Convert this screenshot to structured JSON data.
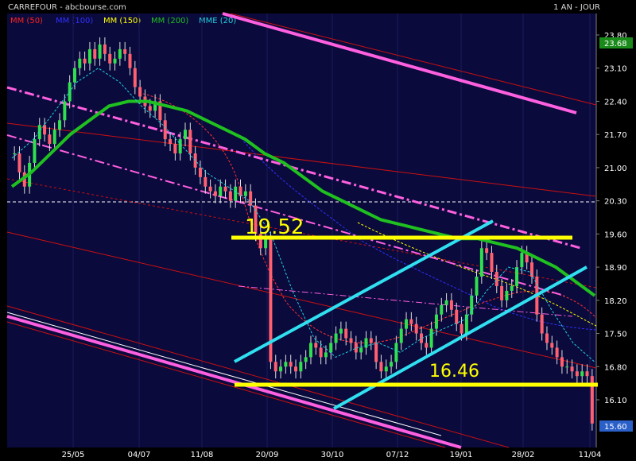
{
  "header": {
    "title": "CARREFOUR - abcbourse.com",
    "period": "1 AN - JOUR"
  },
  "legend": [
    {
      "label": "MM (50)",
      "color": "#ff2020"
    },
    {
      "label": "MM (100)",
      "color": "#2020ff"
    },
    {
      "label": "MM (150)",
      "color": "#ffff00"
    },
    {
      "label": "MM (200)",
      "color": "#20c020"
    },
    {
      "label": "MME (20)",
      "color": "#20d0e0"
    }
  ],
  "annotations": {
    "resistance_label": "19.52",
    "support_label": "16.46"
  },
  "chart_data": {
    "type": "line",
    "title": "CARREFOUR - abcbourse.com",
    "period": "1 AN - JOUR",
    "y_ticks": [
      "23.80",
      "23.10",
      "22.40",
      "21.70",
      "21.00",
      "20.30",
      "19.60",
      "18.90",
      "18.20",
      "17.50",
      "16.80",
      "16.10"
    ],
    "x_ticks": [
      "25/05",
      "04/07",
      "11/08",
      "20/09",
      "30/10",
      "07/12",
      "19/01",
      "28/02",
      "11/04"
    ],
    "ylim": [
      15.4,
      24.0
    ],
    "last_price_label": "23.68",
    "last_close_label": "15.60",
    "reference_price": 20.3,
    "levels": [
      {
        "name": "resistance",
        "value": 19.52,
        "color": "#ffff00"
      },
      {
        "name": "support",
        "value": 16.46,
        "color": "#ffff00"
      }
    ],
    "close": [
      21.3,
      20.9,
      20.6,
      21.1,
      21.6,
      21.9,
      21.7,
      21.5,
      21.8,
      22.0,
      22.4,
      22.8,
      23.1,
      23.3,
      23.2,
      23.5,
      23.3,
      23.6,
      23.4,
      23.2,
      23.3,
      23.5,
      23.4,
      23.1,
      22.7,
      22.5,
      22.3,
      22.2,
      22.4,
      22.0,
      21.6,
      21.5,
      21.3,
      21.6,
      21.8,
      21.3,
      21.0,
      20.8,
      20.6,
      20.5,
      20.4,
      20.6,
      20.5,
      20.3,
      20.6,
      20.4,
      20.5,
      20.2,
      19.6,
      19.3,
      19.5,
      16.9,
      16.7,
      16.8,
      16.9,
      16.8,
      16.7,
      16.9,
      17.0,
      17.3,
      17.2,
      17.0,
      17.1,
      17.3,
      17.5,
      17.6,
      17.4,
      17.3,
      17.1,
      17.2,
      17.4,
      17.3,
      16.9,
      16.7,
      16.8,
      16.9,
      17.3,
      17.6,
      17.8,
      17.7,
      17.5,
      17.3,
      17.2,
      17.6,
      17.9,
      18.1,
      18.2,
      18.0,
      17.7,
      17.5,
      17.9,
      18.3,
      18.7,
      19.3,
      19.2,
      18.8,
      18.5,
      18.2,
      18.4,
      18.5,
      18.9,
      19.2,
      19.0,
      18.7,
      17.9,
      17.5,
      17.3,
      17.2,
      17.0,
      16.8,
      16.8,
      16.7,
      16.6,
      16.7,
      16.6,
      15.6
    ],
    "series": [
      {
        "name": "MM (200)",
        "color": "#20c020",
        "values": [
          20.6,
          20.9,
          21.3,
          21.7,
          22.0,
          22.3,
          22.4,
          22.4,
          22.3,
          22.2,
          22.0,
          21.8,
          21.6,
          21.3,
          21.1,
          20.8,
          20.5,
          20.3,
          20.1,
          19.9,
          19.8,
          19.7,
          19.6,
          19.5,
          19.5,
          19.4,
          19.3,
          19.1,
          18.9,
          18.6,
          18.3
        ]
      },
      {
        "name": "MME (20)",
        "color": "#20d0e0",
        "values": [
          21.2,
          21.6,
          22.2,
          22.8,
          23.1,
          22.8,
          22.3,
          21.9,
          21.4,
          20.9,
          20.6,
          20.3,
          19.6,
          18.4,
          17.4,
          17.0,
          17.2,
          17.3,
          17.1,
          17.4,
          17.6,
          17.8,
          18.4,
          18.9,
          18.8,
          18.0,
          17.3,
          16.9
        ]
      }
    ]
  }
}
